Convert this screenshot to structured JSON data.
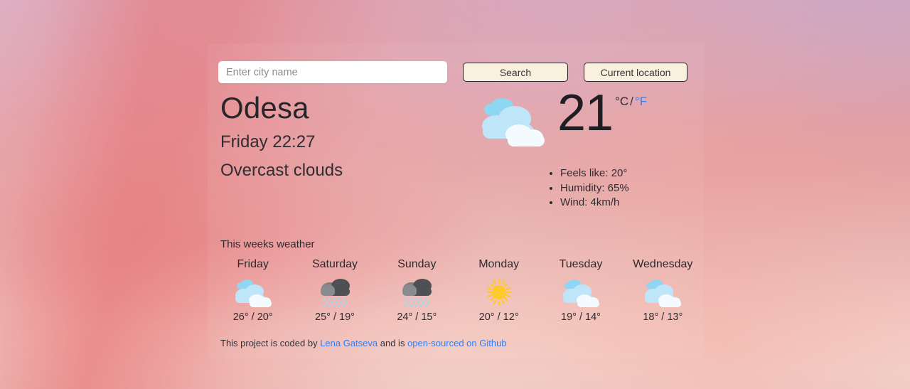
{
  "search": {
    "placeholder": "Enter city name",
    "value": "",
    "search_label": "Search",
    "location_label": "Current location"
  },
  "current": {
    "city": "Odesa",
    "datetime": "Friday 22:27",
    "description": "Overcast clouds",
    "icon": "broken-clouds-icon",
    "temperature": "21",
    "unit_celsius": "°C",
    "unit_separator": "/",
    "unit_fahrenheit": "°F",
    "active_unit": "celsius",
    "details": [
      "Feels like: 20°",
      "Humidity: 65%",
      "Wind: 4km/h"
    ]
  },
  "forecast": {
    "title": "This weeks weather",
    "days": [
      {
        "name": "Friday",
        "icon": "clouds-icon",
        "temps": "26° / 20°",
        "high": 26,
        "low": 20
      },
      {
        "name": "Saturday",
        "icon": "rain-icon",
        "temps": "25° / 19°",
        "high": 25,
        "low": 19
      },
      {
        "name": "Sunday",
        "icon": "rain-icon",
        "temps": "24° / 15°",
        "high": 24,
        "low": 15
      },
      {
        "name": "Monday",
        "icon": "sun-icon",
        "temps": "20° / 12°",
        "high": 20,
        "low": 12
      },
      {
        "name": "Tuesday",
        "icon": "clouds-icon",
        "temps": "19° / 14°",
        "high": 19,
        "low": 14
      },
      {
        "name": "Wednesday",
        "icon": "clouds-icon",
        "temps": "18° / 13°",
        "high": 18,
        "low": 13
      }
    ]
  },
  "footer": {
    "text_before": "This project is coded by ",
    "author_link": "Lena Gatseva",
    "text_middle": " and is ",
    "source_link": "open-sourced on Github"
  },
  "colors": {
    "link": "#2d7ff9",
    "button_bg": "#faf0de",
    "button_border": "#2b2326",
    "text": "#2e2c32",
    "cloud_blue": "#b9e2f5",
    "cloud_white": "#f2fbfe",
    "rain_cloud": "#5f6063",
    "rain_drop": "#9fd8ef",
    "sun": "#ffc92b"
  }
}
